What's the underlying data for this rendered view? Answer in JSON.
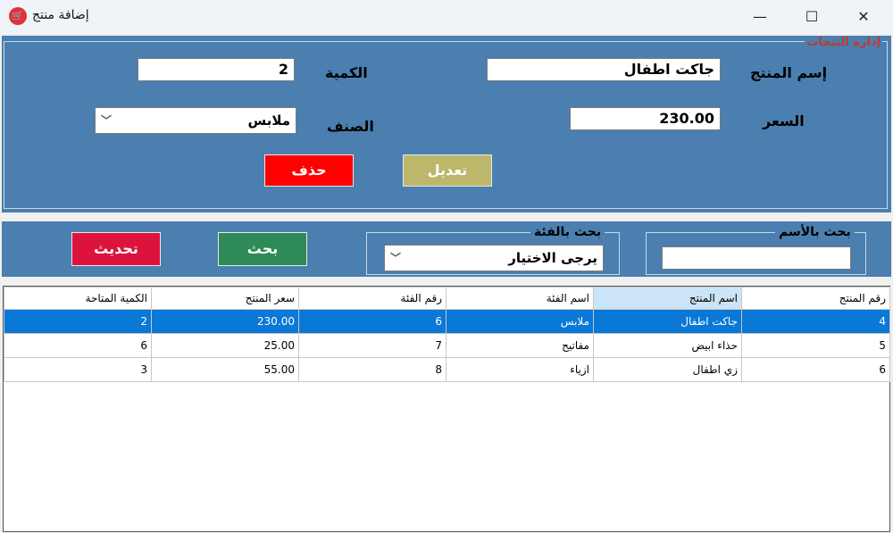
{
  "window": {
    "title": "إضافة منتج",
    "icon": "shop-icon",
    "controls": [
      "minimize-icon",
      "maximize-icon",
      "close-icon"
    ]
  },
  "manage_group": {
    "title": "إدارة النتجات",
    "product_name_label": "إسم المنتج",
    "product_name_value": "جاكت اطفال",
    "quantity_label": "الكمية",
    "quantity_value": "2",
    "price_label": "السعر",
    "price_value": "230.00",
    "category_label": "الصنف",
    "category_value": "ملابس",
    "edit_button": "تعديل",
    "delete_button": "حذف"
  },
  "search": {
    "by_name_label": "بحث بالأسم",
    "by_name_value": "",
    "by_category_label": "بحث بالفئة",
    "by_category_value": "يرجى الاختيار",
    "search_button": "بحث",
    "refresh_button": "تحديث"
  },
  "colors": {
    "panel_blue": "#4a7fb0",
    "edit_button": "#bdb76b",
    "delete_button": "#ff0000",
    "search_button": "#2e8b57",
    "refresh_button": "#dc143c",
    "selected_row": "#0a78d7",
    "group_title": "#c0392b"
  },
  "table": {
    "columns": [
      "رقم المنتج",
      "اسم المنتج",
      "اسم الفئة",
      "رقم الفئة",
      "سعر المنتج",
      "الكمية المتاحة"
    ],
    "rows": [
      [
        "4",
        "جاكت اطفال",
        "ملابس",
        "6",
        "230.00",
        "2"
      ],
      [
        "5",
        "حذاء ابيض",
        "مفاتيح",
        "7",
        "25.00",
        "6"
      ],
      [
        "6",
        "زي اطفال",
        "ازياء",
        "8",
        "55.00",
        "3"
      ]
    ],
    "selected_row": 0
  }
}
